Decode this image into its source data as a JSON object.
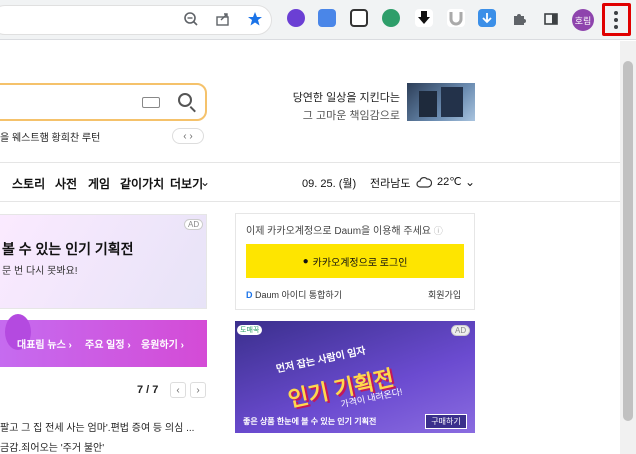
{
  "browser": {
    "profile_label": "호림",
    "icons": [
      "zoom-icon",
      "share-icon",
      "bookmark-star-icon",
      "extensions-puzzle-icon",
      "side-panel-icon",
      "more-menu-icon"
    ]
  },
  "search": {
    "suggestions": "을 웨스트햄   황희찬 루턴"
  },
  "banner_top": {
    "line1": "당연한 일상을 지킨다는",
    "line2": "그 고마운 책임감으로"
  },
  "nav": {
    "items": [
      "스토리",
      "사전",
      "게임",
      "같이가치",
      "더보기"
    ],
    "date": "09. 25. (월)",
    "region": "전라남도",
    "temp": "22℃"
  },
  "feature_card": {
    "ad": "AD",
    "title": "볼 수 있는 인기 기획전",
    "subtitle": "문 번 다시 못봐요!",
    "links": [
      "대표림 뉴스 ›",
      "주요 일정 ›",
      "응원하기 ›"
    ]
  },
  "pager": {
    "count": "7 / 7"
  },
  "news": {
    "line1": "팔고 그 집 전세 사는 엄마'.편법 증여 등 의심 ...",
    "line2": "금감.죄어오는 '주거 불안'"
  },
  "login": {
    "prompt": "이제 카카오계정으로 Daum을 이용해 주세요",
    "button": "카카오계정으로 로그인",
    "integrate": "Daum 아이디 통합하기",
    "signup": "회원가입"
  },
  "ad_banner": {
    "brand": "도매꾹",
    "ad": "AD",
    "headline1": "먼저 잡는 사람이 임자",
    "headline2": "인기 기획전",
    "headline3": "가격이 내려온다!",
    "caption": "좋은 상품 한눈에 볼 수 있는 인기 기획전",
    "cta": "구매하기"
  }
}
